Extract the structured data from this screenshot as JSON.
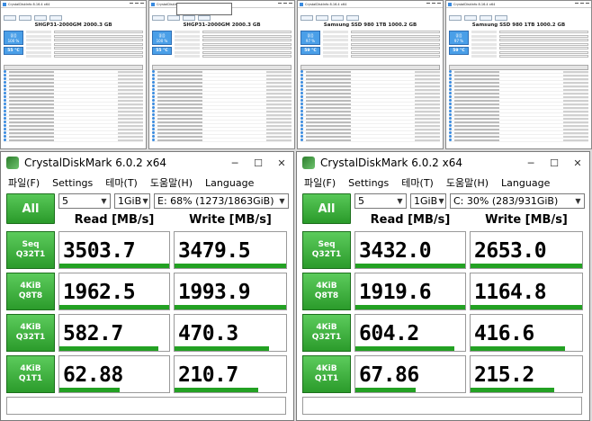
{
  "cdi": [
    {
      "title": "CrystalDiskInfo 8.16.4 x64",
      "model": "SHGP31-2000GM 2000.3 GB",
      "health_label": "좋음",
      "health_pct": "100 %",
      "temp": "55 °C"
    },
    {
      "title": "CrystalDiskInfo 8.16.4 x64",
      "model": "SHGP31-2000GM 2000.3 GB",
      "health_label": "좋음",
      "health_pct": "100 %",
      "temp": "55 °C"
    },
    {
      "title": "CrystalDiskInfo 8.16.4 x64",
      "model": "Samsung SSD 980 1TB 1000.2 GB",
      "health_label": "좋음",
      "health_pct": "97 %",
      "temp": "59 °C"
    },
    {
      "title": "CrystalDiskInfo 8.16.4 x64",
      "model": "Samsung SSD 980 1TB 1000.2 GB",
      "health_label": "좋음",
      "health_pct": "97 %",
      "temp": "59 °C"
    }
  ],
  "cdm": [
    {
      "title": "CrystalDiskMark 6.0.2 x64",
      "menu": [
        "파일(F)",
        "Settings",
        "테마(T)",
        "도움말(H)",
        "Language"
      ],
      "all_label": "All",
      "count": "5",
      "size": "1GiB",
      "drive": "E: 68% (1273/1863GiB)",
      "read_header": "Read [MB/s]",
      "write_header": "Write [MB/s]",
      "tests": [
        {
          "l1": "Seq",
          "l2": "Q32T1",
          "read": "3503.7",
          "write": "3479.5",
          "read_frac": 1.0,
          "write_frac": 1.0
        },
        {
          "l1": "4KiB",
          "l2": "Q8T8",
          "read": "1962.5",
          "write": "1993.9",
          "read_frac": 1.0,
          "write_frac": 1.0
        },
        {
          "l1": "4KiB",
          "l2": "Q32T1",
          "read": "582.7",
          "write": "470.3",
          "read_frac": 0.9,
          "write_frac": 0.85
        },
        {
          "l1": "4KiB",
          "l2": "Q1T1",
          "read": "62.88",
          "write": "210.7",
          "read_frac": 0.55,
          "write_frac": 0.75
        }
      ]
    },
    {
      "title": "CrystalDiskMark 6.0.2 x64",
      "menu": [
        "파일(F)",
        "Settings",
        "테마(T)",
        "도움말(H)",
        "Language"
      ],
      "all_label": "All",
      "count": "5",
      "size": "1GiB",
      "drive": "C: 30% (283/931GiB)",
      "read_header": "Read [MB/s]",
      "write_header": "Write [MB/s]",
      "tests": [
        {
          "l1": "Seq",
          "l2": "Q32T1",
          "read": "3432.0",
          "write": "2653.0",
          "read_frac": 1.0,
          "write_frac": 1.0
        },
        {
          "l1": "4KiB",
          "l2": "Q8T8",
          "read": "1919.6",
          "write": "1164.8",
          "read_frac": 1.0,
          "write_frac": 1.0
        },
        {
          "l1": "4KiB",
          "l2": "Q32T1",
          "read": "604.2",
          "write": "416.6",
          "read_frac": 0.9,
          "write_frac": 0.85
        },
        {
          "l1": "4KiB",
          "l2": "Q1T1",
          "read": "67.86",
          "write": "215.2",
          "read_frac": 0.55,
          "write_frac": 0.75
        }
      ]
    }
  ]
}
